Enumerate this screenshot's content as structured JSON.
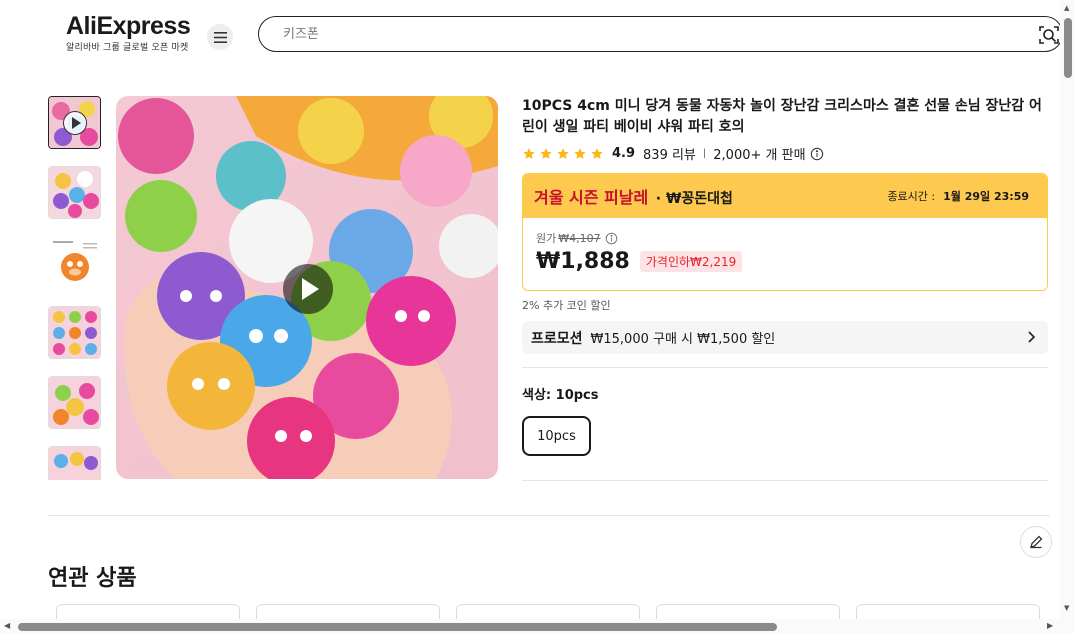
{
  "header": {
    "logo_text": "AliExpress",
    "logo_sub": "알리바바 그룹 글로벌 오픈 마켓",
    "search_placeholder": "키즈폰"
  },
  "product": {
    "title": "10PCS 4cm 미니 당겨 동물 자동차 놀이 장난감 크리스마스 결혼 선물 손님 장난감 어린이 생일 파티 베이비 샤워 파티 호의",
    "rating": "4.9",
    "reviews": "839 리뷰",
    "sold": "2,000+ 개 판매"
  },
  "promo": {
    "title": "겨울 시즌 피날레",
    "subtitle": "· ₩꽁돈대첩",
    "end_label": "종료시간 :",
    "end_time": "1월 29일 23:59",
    "original_label": "원가",
    "original_price": "₩4,107",
    "price": "₩1,888",
    "discount": "가격인하₩2,219"
  },
  "coin_text": "2% 추가 코인 할인",
  "promotion": {
    "tag": "프로모션",
    "text": "₩15,000 구매 시 ₩1,500 할인"
  },
  "color": {
    "label": "색상: 10pcs",
    "option": "10pcs"
  },
  "related": {
    "title": "연관 상품"
  },
  "colors": {
    "accent_yellow": "#fdc94e",
    "promo_red": "#c8102e",
    "discount_bg": "#fde3e5"
  }
}
